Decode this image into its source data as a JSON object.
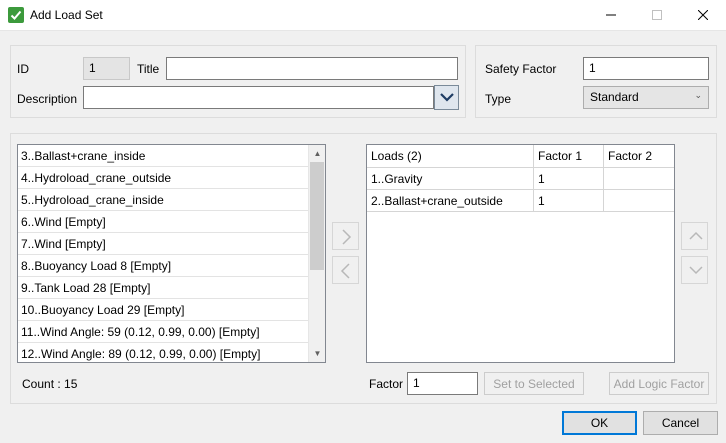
{
  "window": {
    "title": "Add Load Set"
  },
  "header": {
    "id_label": "ID",
    "id_value": "1",
    "title_label": "Title",
    "title_value": "",
    "description_label": "Description",
    "description_value": "",
    "safety_factor_label": "Safety Factor",
    "safety_factor_value": "1",
    "type_label": "Type",
    "type_value": "Standard"
  },
  "available_loads": {
    "items": [
      "3..Ballast+crane_inside",
      "4..Hydroload_crane_outside",
      "5..Hydroload_crane_inside",
      "6..Wind [Empty]",
      "7..Wind [Empty]",
      "8..Buoyancy Load 8 [Empty]",
      "9..Tank Load 28 [Empty]",
      "10..Buoyancy Load 29 [Empty]",
      "11..Wind Angle: 59 (0.12, 0.99, 0.00) [Empty]",
      "12..Wind Angle: 89 (0.12, 0.99, 0.00) [Empty]"
    ],
    "count_label": "Count : 15"
  },
  "selected_loads": {
    "columns": [
      "Loads (2)",
      "Factor 1",
      "Factor 2"
    ],
    "rows": [
      {
        "load": "1..Gravity",
        "factor1": "1",
        "factor2": ""
      },
      {
        "load": "2..Ballast+crane_outside",
        "factor1": "1",
        "factor2": ""
      }
    ]
  },
  "factor": {
    "label": "Factor",
    "value": "1",
    "set_to_selected_label": "Set to Selected",
    "add_logic_factor_label": "Add Logic Factor"
  },
  "footer": {
    "ok_label": "OK",
    "cancel_label": "Cancel"
  },
  "colors": {
    "accent": "#0078d7",
    "app_icon": "#3c9a3c"
  }
}
